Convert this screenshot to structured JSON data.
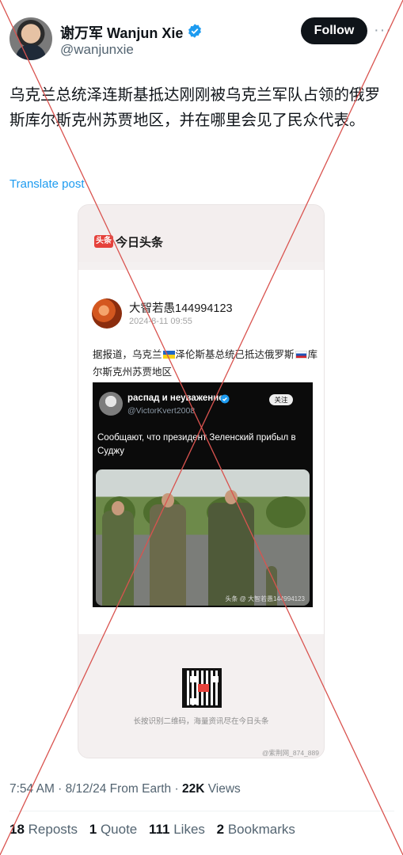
{
  "author": {
    "display_name": "谢万军 Wanjun Xie",
    "handle": "@wanjunxie",
    "verified_icon": "verified-badge-icon",
    "follow_label": "Follow",
    "more_icon": "more-icon"
  },
  "tweet": {
    "text": "乌克兰总统泽连斯基抵达刚刚被乌克兰军队占领的俄罗斯库尔斯克州苏贾地区，并在哪里会见了民众代表。",
    "translate_label": "Translate post"
  },
  "media": {
    "app_badge": "头条",
    "app_name": "今日头条",
    "post_author": "大智若愚144994123",
    "post_time": "2024-8-11 09:55",
    "post_text_a": "据报道，乌克兰",
    "post_text_b": "泽伦斯基总统已抵达俄罗斯",
    "post_text_c": "库尔斯克州苏贾地区",
    "embedded": {
      "name": "распад и неуважение",
      "handle": "@VictorKvert2008",
      "follow_label": "关注",
      "text": "Сообщают, что президент Зеленский прибыл в Суджу",
      "photo_credit": "头条 @ 大智若愚144994123"
    },
    "qr_caption": "长按识别二维码，海量资讯尽在今日头条",
    "watermark": "@紫荆网_874_889"
  },
  "meta": {
    "time": "7:54 AM · 8/12/24 From Earth · ",
    "views_count": "22K",
    "views_label": " Views"
  },
  "stats": {
    "reposts_count": "18",
    "reposts_label": " Reposts",
    "quote_count": "1",
    "quote_label": " Quote",
    "likes_count": "111",
    "likes_label": " Likes",
    "bookmarks_count": "2",
    "bookmarks_label": " Bookmarks"
  },
  "colors": {
    "accent": "#1d9bf0",
    "cross_lines": "#d9534f",
    "app_brand": "#e5413b"
  }
}
